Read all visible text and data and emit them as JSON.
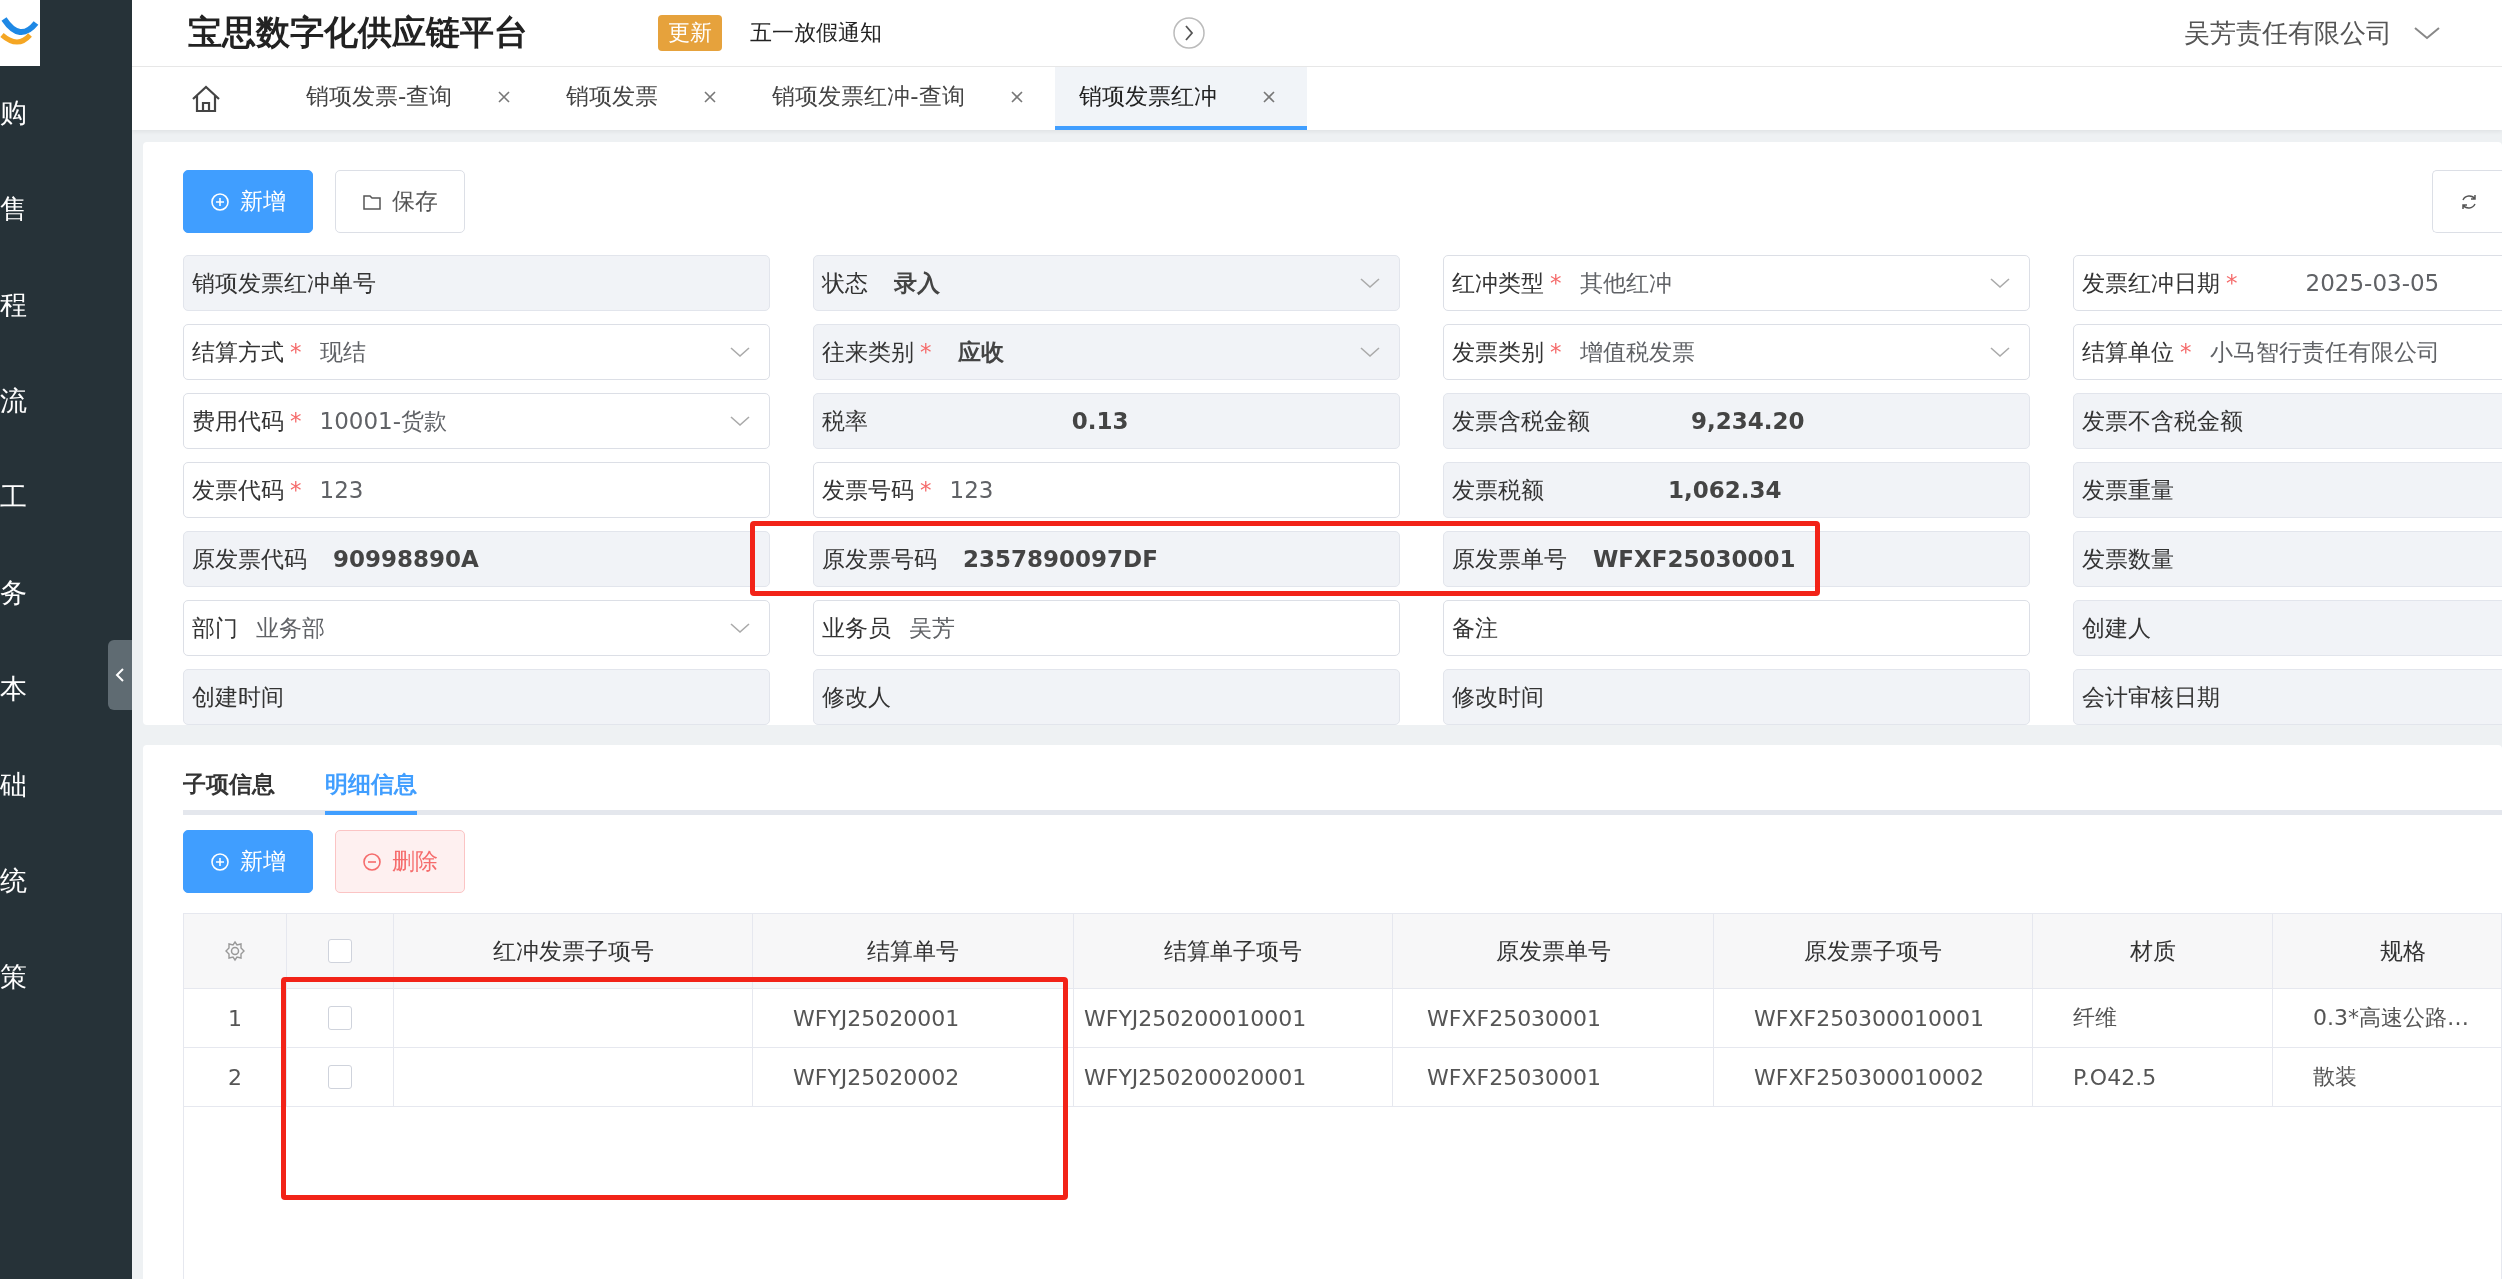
{
  "sidebar": {
    "items": [
      {
        "label": "购"
      },
      {
        "label": "售"
      },
      {
        "label": "程"
      },
      {
        "label": "流"
      },
      {
        "label": "工"
      },
      {
        "label": "务"
      },
      {
        "label": "本"
      },
      {
        "label": "础"
      },
      {
        "label": "统"
      },
      {
        "label": "策"
      }
    ]
  },
  "header": {
    "title": "宝思数字化供应链平台",
    "badge": "更新",
    "notice": "五一放假通知",
    "company": "吴芳责任有限公司"
  },
  "tabs": [
    {
      "label": "销项发票-查询",
      "selected": false
    },
    {
      "label": "销项发票",
      "selected": false
    },
    {
      "label": "销项发票红冲-查询",
      "selected": false
    },
    {
      "label": "销项发票红冲",
      "selected": true
    }
  ],
  "toolbar": {
    "buttons": [
      {
        "label": "新增",
        "kind": "primary"
      },
      {
        "label": "保存",
        "kind": "plain"
      }
    ]
  },
  "form": {
    "columns": [
      [
        {
          "label": "销项发票红冲单号",
          "disabled": true,
          "kind": "text"
        },
        {
          "label": "结算方式",
          "required_mark": "*",
          "disabled": false,
          "kind": "select",
          "value": "现结"
        },
        {
          "label": "费用代码",
          "required_mark": "*",
          "disabled": false,
          "kind": "select",
          "value": "10001-货款"
        },
        {
          "label": "发票代码",
          "required_mark": "*",
          "disabled": false,
          "kind": "text",
          "value": "123"
        },
        {
          "label": "原发票代码",
          "disabled": true,
          "kind": "text",
          "value": "90998890A"
        },
        {
          "label": "部门",
          "disabled": false,
          "kind": "select",
          "value": "业务部"
        },
        {
          "label": "创建时间",
          "disabled": true,
          "kind": "text"
        }
      ],
      [
        {
          "label": "状态",
          "disabled": true,
          "kind": "select",
          "value": "录入"
        },
        {
          "label": "往来类别",
          "required_mark": "*",
          "disabled": true,
          "kind": "select",
          "value": "应收"
        },
        {
          "label": "税率",
          "disabled": true,
          "kind": "number",
          "value": "0.13"
        },
        {
          "label": "发票号码",
          "required_mark": "*",
          "disabled": false,
          "kind": "text",
          "value": "123"
        },
        {
          "label": "原发票号码",
          "disabled": true,
          "kind": "text",
          "value": "2357890097DF"
        },
        {
          "label": "业务员",
          "disabled": false,
          "kind": "text",
          "value": "吴芳"
        },
        {
          "label": "修改人",
          "disabled": true,
          "kind": "text"
        }
      ],
      [
        {
          "label": "红冲类型",
          "required_mark": "*",
          "disabled": false,
          "kind": "select",
          "value": "其他红冲"
        },
        {
          "label": "发票类别",
          "required_mark": "*",
          "disabled": false,
          "kind": "select",
          "value": "增值税发票"
        },
        {
          "label": "发票含税金额",
          "disabled": true,
          "kind": "number",
          "value": "9,234.20"
        },
        {
          "label": "发票税额",
          "disabled": true,
          "kind": "number",
          "value": "1,062.34"
        },
        {
          "label": "原发票单号",
          "disabled": true,
          "kind": "text",
          "value": "WFXF25030001"
        },
        {
          "label": "备注",
          "disabled": false,
          "kind": "text"
        },
        {
          "label": "修改时间",
          "disabled": true,
          "kind": "text"
        }
      ],
      [
        {
          "label": "发票红冲日期",
          "required_mark": "*",
          "disabled": false,
          "kind": "number",
          "value": "2025-03-05"
        },
        {
          "label": "结算单位",
          "required_mark": "*",
          "disabled": false,
          "kind": "text",
          "value": "小马智行责任有限公司"
        },
        {
          "label": "发票不含税金额",
          "disabled": true,
          "kind": "text"
        },
        {
          "label": "发票重量",
          "disabled": true,
          "kind": "text"
        },
        {
          "label": "发票数量",
          "disabled": true,
          "kind": "text"
        },
        {
          "label": "创建人",
          "disabled": true,
          "kind": "text"
        },
        {
          "label": "会计审核日期",
          "disabled": true,
          "kind": "text"
        }
      ]
    ]
  },
  "detail": {
    "tabs": [
      {
        "label": "子项信息",
        "selected": false
      },
      {
        "label": "明细信息",
        "selected": true
      }
    ],
    "buttons": [
      {
        "label": "新增",
        "kind": "primary"
      },
      {
        "label": "删除",
        "kind": "danger"
      }
    ],
    "table": {
      "select_all": false,
      "columns": [
        "红冲发票子项号",
        "结算单号",
        "结算单子项号",
        "原发票单号",
        "原发票子项号",
        "材质",
        "规格"
      ],
      "rows": [
        {
          "index": "1",
          "checked": false,
          "settlement_no": "WFYJ25020001",
          "settlement_item_no": "WFYJ250200010001",
          "orig_invoice_no": "WFXF25030001",
          "orig_invoice_item_no": "WFXF250300010001",
          "material": "纤维",
          "spec": "0.3*高速公路…"
        },
        {
          "index": "2",
          "checked": false,
          "settlement_no": "WFYJ25020002",
          "settlement_item_no": "WFYJ250200020001",
          "orig_invoice_no": "WFXF25030001",
          "orig_invoice_item_no": "WFXF250300010002",
          "material": "P.O42.5",
          "spec": "散装"
        }
      ]
    }
  },
  "annotation_marks": [
    {
      "kind": "rectangle"
    },
    {
      "kind": "rectangle"
    }
  ]
}
